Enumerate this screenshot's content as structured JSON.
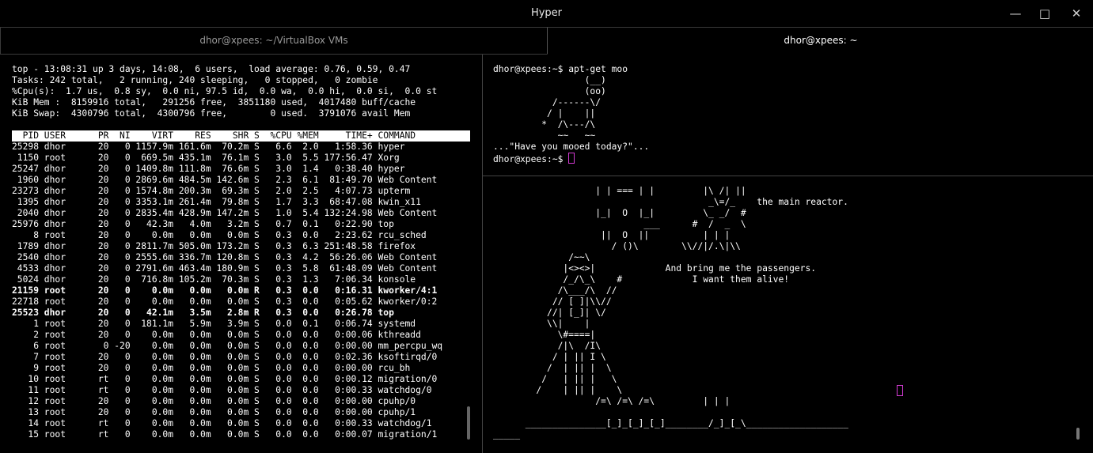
{
  "window": {
    "title": "Hyper"
  },
  "tabs": [
    {
      "label": "dhor@xpees: ~/VirtualBox VMs"
    },
    {
      "label": "dhor@xpees: ~"
    }
  ],
  "top": {
    "line1": "top - 13:08:31 up 3 days, 14:08,  6 users,  load average: 0.76, 0.59, 0.47",
    "line2": "Tasks: 242 total,   2 running, 240 sleeping,   0 stopped,   0 zombie",
    "line3": "%Cpu(s):  1.7 us,  0.8 sy,  0.0 ni, 97.5 id,  0.0 wa,  0.0 hi,  0.0 si,  0.0 st",
    "line4": "KiB Mem :  8159916 total,   291256 free,  3851180 used,  4017480 buff/cache",
    "line5": "KiB Swap:  4300796 total,  4300796 free,        0 used.  3791076 avail Mem",
    "header": "  PID USER      PR  NI    VIRT    RES    SHR S  %CPU %MEM     TIME+ COMMAND",
    "processes": [
      {
        "text": "25298 dhor      20   0 1157.9m 161.6m  70.2m S   6.6  2.0   1:58.36 hyper",
        "bold": false
      },
      {
        "text": " 1150 root      20   0  669.5m 435.1m  76.1m S   3.0  5.5 177:56.47 Xorg",
        "bold": false
      },
      {
        "text": "25247 dhor      20   0 1409.8m 111.8m  76.6m S   3.0  1.4   0:38.40 hyper",
        "bold": false
      },
      {
        "text": " 1960 dhor      20   0 2869.6m 484.5m 142.6m S   2.3  6.1  81:49.70 Web Content",
        "bold": false
      },
      {
        "text": "23273 dhor      20   0 1574.8m 200.3m  69.3m S   2.0  2.5   4:07.73 upterm",
        "bold": false
      },
      {
        "text": " 1395 dhor      20   0 3353.1m 261.4m  79.8m S   1.7  3.3  68:47.08 kwin_x11",
        "bold": false
      },
      {
        "text": " 2040 dhor      20   0 2835.4m 428.9m 147.2m S   1.0  5.4 132:24.98 Web Content",
        "bold": false
      },
      {
        "text": "25976 dhor      20   0   42.3m   4.0m   3.2m S   0.7  0.1   0:22.90 top",
        "bold": false
      },
      {
        "text": "    8 root      20   0    0.0m   0.0m   0.0m S   0.3  0.0   2:23.62 rcu_sched",
        "bold": false
      },
      {
        "text": " 1789 dhor      20   0 2811.7m 505.0m 173.2m S   0.3  6.3 251:48.58 firefox",
        "bold": false
      },
      {
        "text": " 2540 dhor      20   0 2555.6m 336.7m 120.8m S   0.3  4.2  56:26.06 Web Content",
        "bold": false
      },
      {
        "text": " 4533 dhor      20   0 2791.6m 463.4m 180.9m S   0.3  5.8  61:48.09 Web Content",
        "bold": false
      },
      {
        "text": " 5024 dhor      20   0  716.8m 105.2m  70.3m S   0.3  1.3   7:06.34 konsole",
        "bold": false
      },
      {
        "text": "21159 root      20   0    0.0m   0.0m   0.0m R   0.3  0.0   0:16.31 kworker/4:1",
        "bold": true
      },
      {
        "text": "22718 root      20   0    0.0m   0.0m   0.0m S   0.3  0.0   0:05.62 kworker/0:2",
        "bold": false
      },
      {
        "text": "25523 dhor      20   0   42.1m   3.5m   2.8m R   0.3  0.0   0:26.78 top",
        "bold": true
      },
      {
        "text": "    1 root      20   0  181.1m   5.9m   3.9m S   0.0  0.1   0:06.74 systemd",
        "bold": false
      },
      {
        "text": "    2 root      20   0    0.0m   0.0m   0.0m S   0.0  0.0   0:00.06 kthreadd",
        "bold": false
      },
      {
        "text": "    6 root       0 -20    0.0m   0.0m   0.0m S   0.0  0.0   0:00.00 mm_percpu_wq",
        "bold": false
      },
      {
        "text": "    7 root      20   0    0.0m   0.0m   0.0m S   0.0  0.0   0:02.36 ksoftirqd/0",
        "bold": false
      },
      {
        "text": "    9 root      20   0    0.0m   0.0m   0.0m S   0.0  0.0   0:00.00 rcu_bh",
        "bold": false
      },
      {
        "text": "   10 root      rt   0    0.0m   0.0m   0.0m S   0.0  0.0   0:00.12 migration/0",
        "bold": false
      },
      {
        "text": "   11 root      rt   0    0.0m   0.0m   0.0m S   0.0  0.0   0:00.33 watchdog/0",
        "bold": false
      },
      {
        "text": "   12 root      20   0    0.0m   0.0m   0.0m S   0.0  0.0   0:00.00 cpuhp/0",
        "bold": false
      },
      {
        "text": "   13 root      20   0    0.0m   0.0m   0.0m S   0.0  0.0   0:00.00 cpuhp/1",
        "bold": false
      },
      {
        "text": "   14 root      rt   0    0.0m   0.0m   0.0m S   0.0  0.0   0:00.33 watchdog/1",
        "bold": false
      },
      {
        "text": "   15 root      rt   0    0.0m   0.0m   0.0m S   0.0  0.0   0:00.07 migration/1",
        "bold": false
      }
    ]
  },
  "moo": {
    "prompt_cmd": "dhor@xpees:~$ apt-get moo",
    "art": "                 (__)\n                 (oo)\n           /------\\/\n          / |    ||\n         *  /\\---/\\\n            ~~   ~~\n...\"Have you mooed today?\"...",
    "prompt": "dhor@xpees:~$ "
  },
  "ascii": {
    "art": "                   | | === | |         |\\ /| ||\n                                        _\\=/_    the main reactor.\n                   |_|  O  |_|         \\_ _/  #\n                            ___      #  /  _  \\\n                    ||  O  ||          | | |\n                      / ()\\        \\\\//|/.\\|\\\\\n              /~~\\\n             |<><>|             And bring me the passengers.\n             /_/\\_\\    #             I want them alive!\n            /\\___/\\  //\n           // [ ]|\\\\//\n          //| [_]| \\/\n          \\\\|    |\n            \\#====|\n            /|\\  /I\\\n           / | || I \\\n          /  | || |  \\\n         /   | || |   \\\n        /    | || |    \\\n                   /=\\ /=\\ /=\\         | | |\n\n      _______________[_]_[_]_[_]________/_]_[_\\___________________\n_____"
  }
}
